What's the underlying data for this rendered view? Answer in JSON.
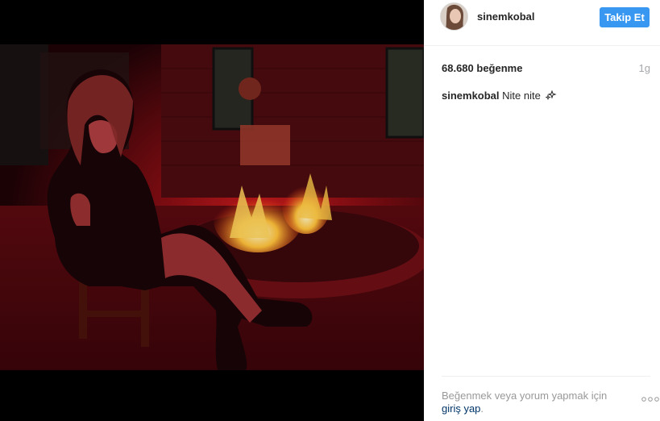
{
  "post": {
    "username": "sinemkobal",
    "follow_label": "Takip Et",
    "likes": "68.680 beğenme",
    "time_ago": "1g",
    "caption_user": "sinemkobal",
    "caption_text": "Nite nite",
    "caption_emoji": "sparkles-icon"
  },
  "footer": {
    "prompt": "Beğenmek veya yorum yapmak için",
    "login_link": "giriş yap",
    "suffix": "."
  },
  "colors": {
    "follow_button": "#3897f0",
    "link": "#003569",
    "muted": "#999999"
  }
}
